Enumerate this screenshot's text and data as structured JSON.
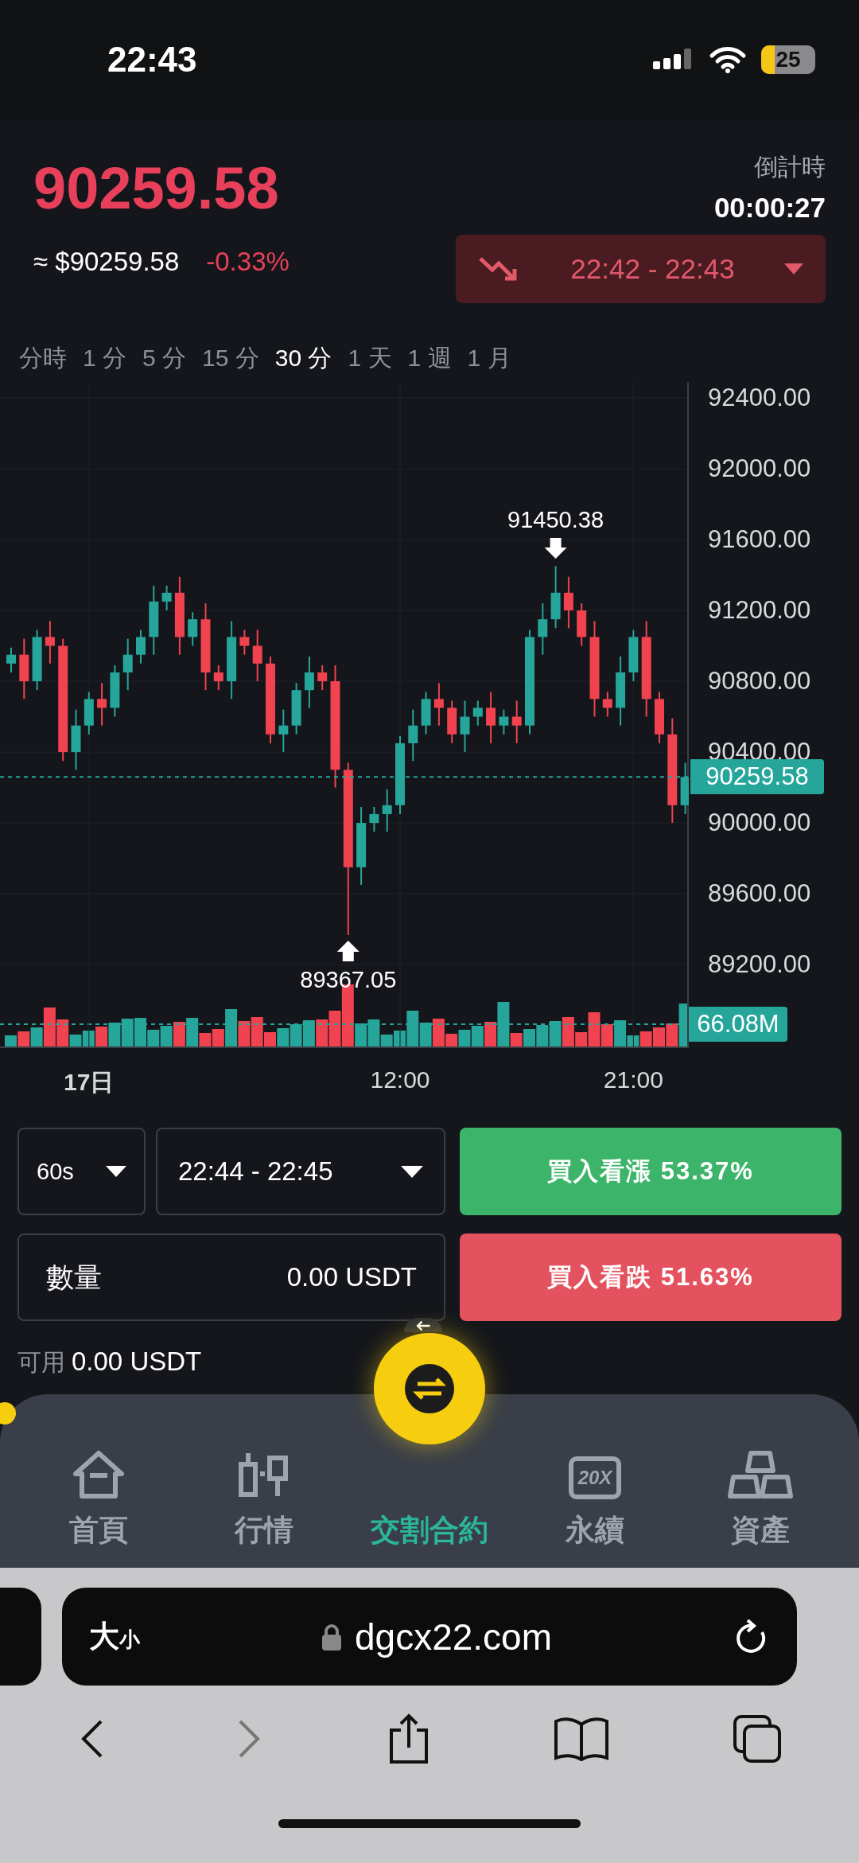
{
  "status_bar": {
    "time": "22:43",
    "battery": "25"
  },
  "header": {
    "price": "90259.58",
    "approx_price": "≈ $90259.58",
    "change": "-0.33%",
    "countdown_label": "倒計時",
    "countdown": "00:00:27",
    "period_selector": {
      "falling": true,
      "range": "22:42 - 22:43"
    }
  },
  "timeframes": [
    {
      "label": "分時",
      "selected": false
    },
    {
      "label": "1 分",
      "selected": false
    },
    {
      "label": "5 分",
      "selected": false
    },
    {
      "label": "15 分",
      "selected": false
    },
    {
      "label": "30 分",
      "selected": true
    },
    {
      "label": "1 天",
      "selected": false
    },
    {
      "label": "1 週",
      "selected": false
    },
    {
      "label": "1 月",
      "selected": false
    }
  ],
  "chart": {
    "high_marker": "91450.38",
    "low_marker": "89367.05",
    "last_price": "90259.58",
    "volume_label": "66.08M",
    "chart_data": {
      "type": "candlestick",
      "categories": [
        null,
        null,
        null,
        null,
        null,
        null,
        "17日",
        null,
        null,
        null,
        null,
        null,
        null,
        null,
        null,
        null,
        null,
        null,
        null,
        null,
        null,
        null,
        null,
        null,
        null,
        null,
        null,
        null,
        null,
        null,
        "12:00",
        null,
        null,
        null,
        null,
        null,
        null,
        null,
        null,
        null,
        null,
        null,
        null,
        null,
        null,
        null,
        null,
        null,
        "21:00",
        null,
        null,
        null,
        null
      ],
      "ylim": [
        88733,
        92490
      ],
      "grid": true,
      "ref_lines": [
        {
          "axis": "y",
          "value": 90259.58
        }
      ],
      "ohlc": [
        [
          90900,
          90990,
          90850,
          90950
        ],
        [
          90950,
          91040,
          90700,
          90800
        ],
        [
          90800,
          91090,
          90750,
          91050
        ],
        [
          91050,
          91140,
          90900,
          91000
        ],
        [
          91000,
          91040,
          90350,
          90400
        ],
        [
          90400,
          90640,
          90300,
          90550
        ],
        [
          90550,
          90740,
          90500,
          90700
        ],
        [
          90700,
          90790,
          90550,
          90650
        ],
        [
          90650,
          90890,
          90600,
          90850
        ],
        [
          90850,
          91040,
          90750,
          90950
        ],
        [
          90950,
          91090,
          90900,
          91050
        ],
        [
          91050,
          91340,
          90950,
          91250
        ],
        [
          91250,
          91340,
          91200,
          91300
        ],
        [
          91300,
          91390,
          90950,
          91050
        ],
        [
          91050,
          91190,
          91000,
          91150
        ],
        [
          91150,
          91240,
          90750,
          90850
        ],
        [
          90850,
          90890,
          90750,
          90800
        ],
        [
          90800,
          91140,
          90700,
          91050
        ],
        [
          91050,
          91090,
          90950,
          91000
        ],
        [
          91000,
          91090,
          90800,
          90900
        ],
        [
          90900,
          90940,
          90450,
          90500
        ],
        [
          90500,
          90640,
          90400,
          90550
        ],
        [
          90550,
          90790,
          90500,
          90750
        ],
        [
          90750,
          90940,
          90650,
          90850
        ],
        [
          90850,
          90890,
          90750,
          90800
        ],
        [
          90800,
          90890,
          90200,
          90300
        ],
        [
          90300,
          90340,
          89367.05,
          89750
        ],
        [
          89750,
          90090,
          89650,
          90000
        ],
        [
          90000,
          90090,
          89950,
          90050
        ],
        [
          90050,
          90190,
          89950,
          90100
        ],
        [
          90100,
          90490,
          90050,
          90450
        ],
        [
          90450,
          90640,
          90350,
          90550
        ],
        [
          90550,
          90740,
          90500,
          90700
        ],
        [
          90700,
          90790,
          90550,
          90650
        ],
        [
          90650,
          90690,
          90450,
          90500
        ],
        [
          90500,
          90690,
          90400,
          90600
        ],
        [
          90600,
          90690,
          90550,
          90650
        ],
        [
          90650,
          90740,
          90450,
          90550
        ],
        [
          90550,
          90640,
          90500,
          90600
        ],
        [
          90600,
          90690,
          90450,
          90550
        ],
        [
          90550,
          91090,
          90500,
          91050
        ],
        [
          91050,
          91240,
          90950,
          91150
        ],
        [
          91150,
          91450.38,
          91100,
          91300
        ],
        [
          91300,
          91390,
          91100,
          91200
        ],
        [
          91200,
          91240,
          91000,
          91050
        ],
        [
          91050,
          91140,
          90600,
          90700
        ],
        [
          90700,
          90740,
          90600,
          90650
        ],
        [
          90650,
          90940,
          90550,
          90850
        ],
        [
          90850,
          91090,
          90800,
          91050
        ],
        [
          91050,
          91140,
          90600,
          90700
        ],
        [
          90700,
          90740,
          90450,
          90500
        ],
        [
          90500,
          90590,
          90000,
          90100
        ],
        [
          90100,
          90340,
          90050,
          90259.58
        ]
      ],
      "yticks": [
        {
          "value": 92400,
          "label": "92400.00"
        },
        {
          "value": 92000,
          "label": "92000.00"
        },
        {
          "value": 91600,
          "label": "91600.00"
        },
        {
          "value": 91200,
          "label": "91200.00"
        },
        {
          "value": 90800,
          "label": "90800.00"
        },
        {
          "value": 90400,
          "label": "90400.00"
        },
        {
          "value": 90000,
          "label": "90000.00"
        },
        {
          "value": 89600,
          "label": "89600.00"
        },
        {
          "value": 89200,
          "label": "89200.00"
        }
      ]
    }
  },
  "order": {
    "duration": "60s",
    "period": "22:44 - 22:45",
    "amount_label": "數量",
    "amount": "0.00 USDT",
    "buy_up": "買入看漲 53.37%",
    "buy_down": "買入看跌 51.63%",
    "available_label": "可用",
    "available": "0.00 USDT"
  },
  "nav": [
    {
      "kind": "home",
      "label": "首頁",
      "selected": false
    },
    {
      "kind": "market",
      "label": "行情",
      "selected": false
    },
    {
      "kind": "center",
      "label": "交割合約",
      "selected": true
    },
    {
      "kind": "perpetual",
      "label": "永續",
      "selected": false,
      "icon_text": "20X"
    },
    {
      "kind": "assets",
      "label": "資產",
      "selected": false
    }
  ],
  "browser": {
    "text_size": {
      "large": "大",
      "small": "小"
    },
    "url": "dgcx22.com"
  }
}
